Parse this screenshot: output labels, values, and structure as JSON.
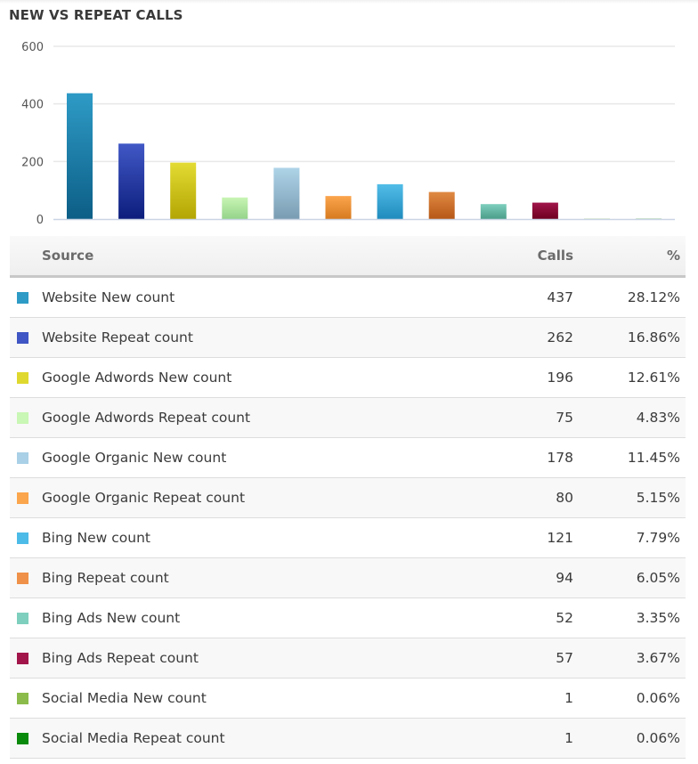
{
  "title": "NEW VS REPEAT CALLS",
  "table": {
    "headers": {
      "source": "Source",
      "calls": "Calls",
      "pct": "%"
    },
    "rows": [
      {
        "label": "Website New count",
        "calls": "437",
        "pct": "28.12%",
        "color": "#2e9bc6"
      },
      {
        "label": "Website Repeat count",
        "calls": "262",
        "pct": "16.86%",
        "color": "#3f56c4"
      },
      {
        "label": "Google Adwords New count",
        "calls": "196",
        "pct": "12.61%",
        "color": "#dfd92f"
      },
      {
        "label": "Google Adwords Repeat count",
        "calls": "75",
        "pct": "4.83%",
        "color": "#c9f7b5"
      },
      {
        "label": "Google Organic New count",
        "calls": "178",
        "pct": "11.45%",
        "color": "#a9d0e6"
      },
      {
        "label": "Google Organic Repeat count",
        "calls": "80",
        "pct": "5.15%",
        "color": "#fba54d"
      },
      {
        "label": "Bing New count",
        "calls": "121",
        "pct": "7.79%",
        "color": "#4dbbe7"
      },
      {
        "label": "Bing Repeat count",
        "calls": "94",
        "pct": "6.05%",
        "color": "#ef9148"
      },
      {
        "label": "Bing Ads New count",
        "calls": "52",
        "pct": "3.35%",
        "color": "#7ecfbd"
      },
      {
        "label": "Bing Ads Repeat count",
        "calls": "57",
        "pct": "3.67%",
        "color": "#a1154a"
      },
      {
        "label": "Social Media New count",
        "calls": "1",
        "pct": "0.06%",
        "color": "#8bbb4b"
      },
      {
        "label": "Social Media Repeat count",
        "calls": "1",
        "pct": "0.06%",
        "color": "#0a8a0a"
      }
    ]
  },
  "chart_data": {
    "type": "bar",
    "title": "NEW VS REPEAT CALLS",
    "xlabel": "",
    "ylabel": "",
    "ylim": [
      0,
      600
    ],
    "yticks": [
      0,
      200,
      400,
      600
    ],
    "ytick_labels": [
      "0",
      "200",
      "400",
      "600"
    ],
    "grid": true,
    "legend": "none",
    "categories": [
      "Website New count",
      "Website Repeat count",
      "Google Adwords New count",
      "Google Adwords Repeat count",
      "Google Organic New count",
      "Google Organic Repeat count",
      "Bing New count",
      "Bing Repeat count",
      "Bing Ads New count",
      "Bing Ads Repeat count",
      "Social Media New count",
      "Social Media Repeat count"
    ],
    "values": [
      437,
      262,
      196,
      75,
      178,
      80,
      121,
      94,
      52,
      57,
      1,
      1
    ],
    "colors_top": [
      "#2e9bc6",
      "#4158c6",
      "#e3dc33",
      "#c8f5b4",
      "#aed4e8",
      "#fba54d",
      "#52bde8",
      "#e08a44",
      "#7ecfbd",
      "#a1154a",
      "#8bbb4b",
      "#0a8a0a"
    ],
    "colors_bottom": [
      "#0c5e86",
      "#0c1d7c",
      "#b3a503",
      "#94d38a",
      "#7a9cb2",
      "#d77a1f",
      "#1f8bbd",
      "#b65716",
      "#4a9d89",
      "#6e0020",
      "#5a8a2a",
      "#006000"
    ]
  }
}
